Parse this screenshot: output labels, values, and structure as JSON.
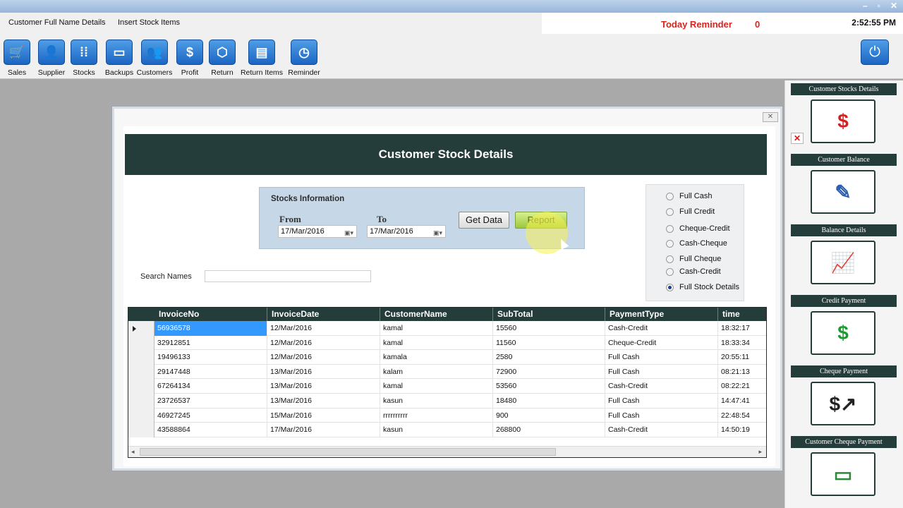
{
  "menu": {
    "items": [
      "Customer Full Name Details",
      "Insert Stock Items"
    ],
    "reminder_label": "Today Reminder",
    "reminder_count": "0",
    "clock": "2:52:55 PM"
  },
  "toolbar": {
    "items": [
      {
        "label": "Sales",
        "glyph": "🛒"
      },
      {
        "label": "Supplier",
        "glyph": "👤"
      },
      {
        "label": "Stocks",
        "glyph": "⁞⁞"
      },
      {
        "label": "Backups",
        "glyph": "▭"
      },
      {
        "label": "Customers",
        "glyph": "👥"
      },
      {
        "label": "Profit",
        "glyph": "$"
      },
      {
        "label": "Return",
        "glyph": "⬡"
      },
      {
        "label": "Return Items",
        "glyph": "▤"
      },
      {
        "label": "Reminder",
        "glyph": "◷"
      }
    ],
    "power_glyph": "⏻"
  },
  "form": {
    "title": "Customer Stock Details",
    "stocks_info": "Stocks Information",
    "from_label": "From",
    "to_label": "To",
    "from_date": "17/Mar/2016",
    "to_date": "17/Mar/2016",
    "get_data": "Get Data",
    "report": "Report",
    "search_label": "Search Names",
    "search_value": ""
  },
  "radios": [
    {
      "label": "Full Cash",
      "checked": false
    },
    {
      "label": "Full Credit",
      "checked": false
    },
    {
      "label": "Cheque-Credit",
      "checked": false
    },
    {
      "label": "Cash-Cheque",
      "checked": false
    },
    {
      "label": "Full Cheque",
      "checked": false
    },
    {
      "label": "Cash-Credit",
      "checked": false
    },
    {
      "label": "Full Stock Details",
      "checked": true
    }
  ],
  "grid": {
    "columns": [
      "InvoiceNo",
      "InvoiceDate",
      "CustomerName",
      "SubTotal",
      "PaymentType",
      "time"
    ],
    "rows": [
      [
        "56936578",
        "12/Mar/2016",
        "kamal",
        "15560",
        "Cash-Credit",
        "18:32:17"
      ],
      [
        "32912851",
        "12/Mar/2016",
        "kamal",
        "11560",
        "Cheque-Credit",
        "18:33:34"
      ],
      [
        "19496133",
        "12/Mar/2016",
        "kamala",
        "2580",
        "Full Cash",
        "20:55:11"
      ],
      [
        "29147448",
        "13/Mar/2016",
        "kalam",
        "72900",
        "Full Cash",
        "08:21:13"
      ],
      [
        "67264134",
        "13/Mar/2016",
        "kamal",
        "53560",
        "Cash-Credit",
        "08:22:21"
      ],
      [
        "23726537",
        "13/Mar/2016",
        "kasun",
        "18480",
        "Full Cash",
        "14:47:41"
      ],
      [
        "46927245",
        "15/Mar/2016",
        "rrrrrrrrrr",
        "900",
        "Full Cash",
        "22:48:54"
      ],
      [
        "43588864",
        "17/Mar/2016",
        "kasun",
        "268800",
        "Cash-Credit",
        "14:50:19"
      ]
    ],
    "selected_row": 0
  },
  "side_tiles": [
    {
      "label": "Customer Stocks Details",
      "glyph": "$",
      "color": "#d42020"
    },
    {
      "label": "Customer Balance",
      "glyph": "✎",
      "color": "#2a5db0"
    },
    {
      "label": "Balance Details",
      "glyph": "📈",
      "color": "#2a7ad0"
    },
    {
      "label": "Credit Payment",
      "glyph": "$",
      "color": "#1c9a2e"
    },
    {
      "label": "Cheque Payment",
      "glyph": "$↗",
      "color": "#222222"
    },
    {
      "label": "Customer Cheque Payment",
      "glyph": "▭",
      "color": "#2a8a3a"
    }
  ]
}
